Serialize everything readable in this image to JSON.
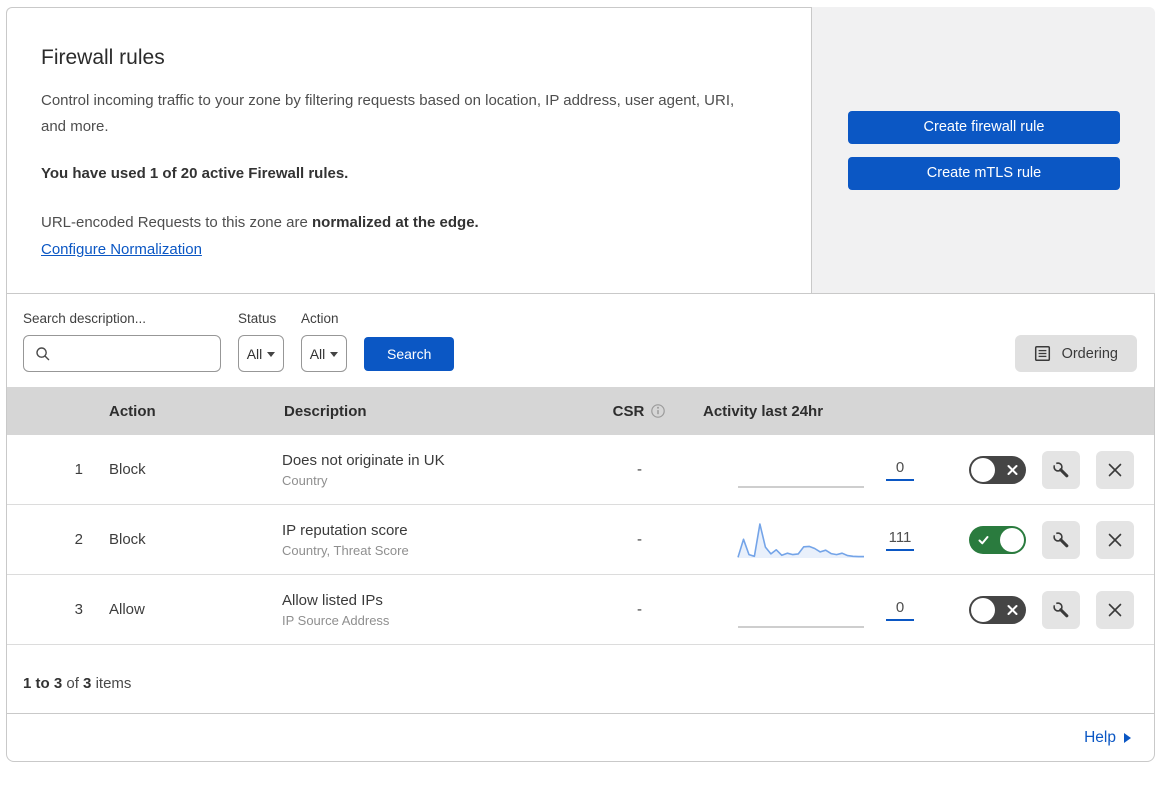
{
  "header": {
    "title": "Firewall rules",
    "description": "Control incoming traffic to your zone by filtering requests based on location, IP address, user agent, URI, and more.",
    "usage_notice": "You have used 1 of 20 active Firewall rules.",
    "normalization_prefix": "URL-encoded Requests to this zone are",
    "normalization_bold": "normalized at the edge.",
    "normalization_link": "Configure Normalization",
    "create_firewall_button": "Create firewall rule",
    "create_mtls_button": "Create mTLS rule"
  },
  "filters": {
    "search_label": "Search description...",
    "status_label": "Status",
    "status_value": "All",
    "action_label": "Action",
    "action_value": "All",
    "search_button": "Search",
    "ordering_button": "Ordering"
  },
  "table": {
    "headers": {
      "action": "Action",
      "description": "Description",
      "csr": "CSR",
      "activity": "Activity last 24hr"
    },
    "rows": [
      {
        "priority": "1",
        "action": "Block",
        "description": "Does not originate in UK",
        "fields": "Country",
        "csr": "-",
        "activity_count": "0",
        "activity_sparkline": null,
        "enabled": false
      },
      {
        "priority": "2",
        "action": "Block",
        "description": "IP reputation score",
        "fields": "Country, Threat Score",
        "csr": "-",
        "activity_count": "111",
        "activity_sparkline": [
          2,
          55,
          10,
          5,
          100,
          32,
          12,
          24,
          8,
          14,
          10,
          12,
          33,
          34,
          28,
          18,
          23,
          13,
          10,
          14,
          7,
          5,
          4,
          4
        ],
        "enabled": true
      },
      {
        "priority": "3",
        "action": "Allow",
        "description": "Allow listed IPs",
        "fields": "IP Source Address",
        "csr": "-",
        "activity_count": "0",
        "activity_sparkline": null,
        "enabled": false
      }
    ]
  },
  "footer": {
    "range": "1 to 3",
    "of": "of",
    "total": "3",
    "items": "items"
  },
  "help": {
    "label": "Help"
  },
  "colors": {
    "accent_blue": "#0b57c4",
    "toggle_on_green": "#2a7b3e",
    "toggle_off_gray": "#454545",
    "panel_gray": "#f1f1f2",
    "table_header_gray": "#d6d6d6",
    "sparkline_blue": "#74a4e8"
  }
}
